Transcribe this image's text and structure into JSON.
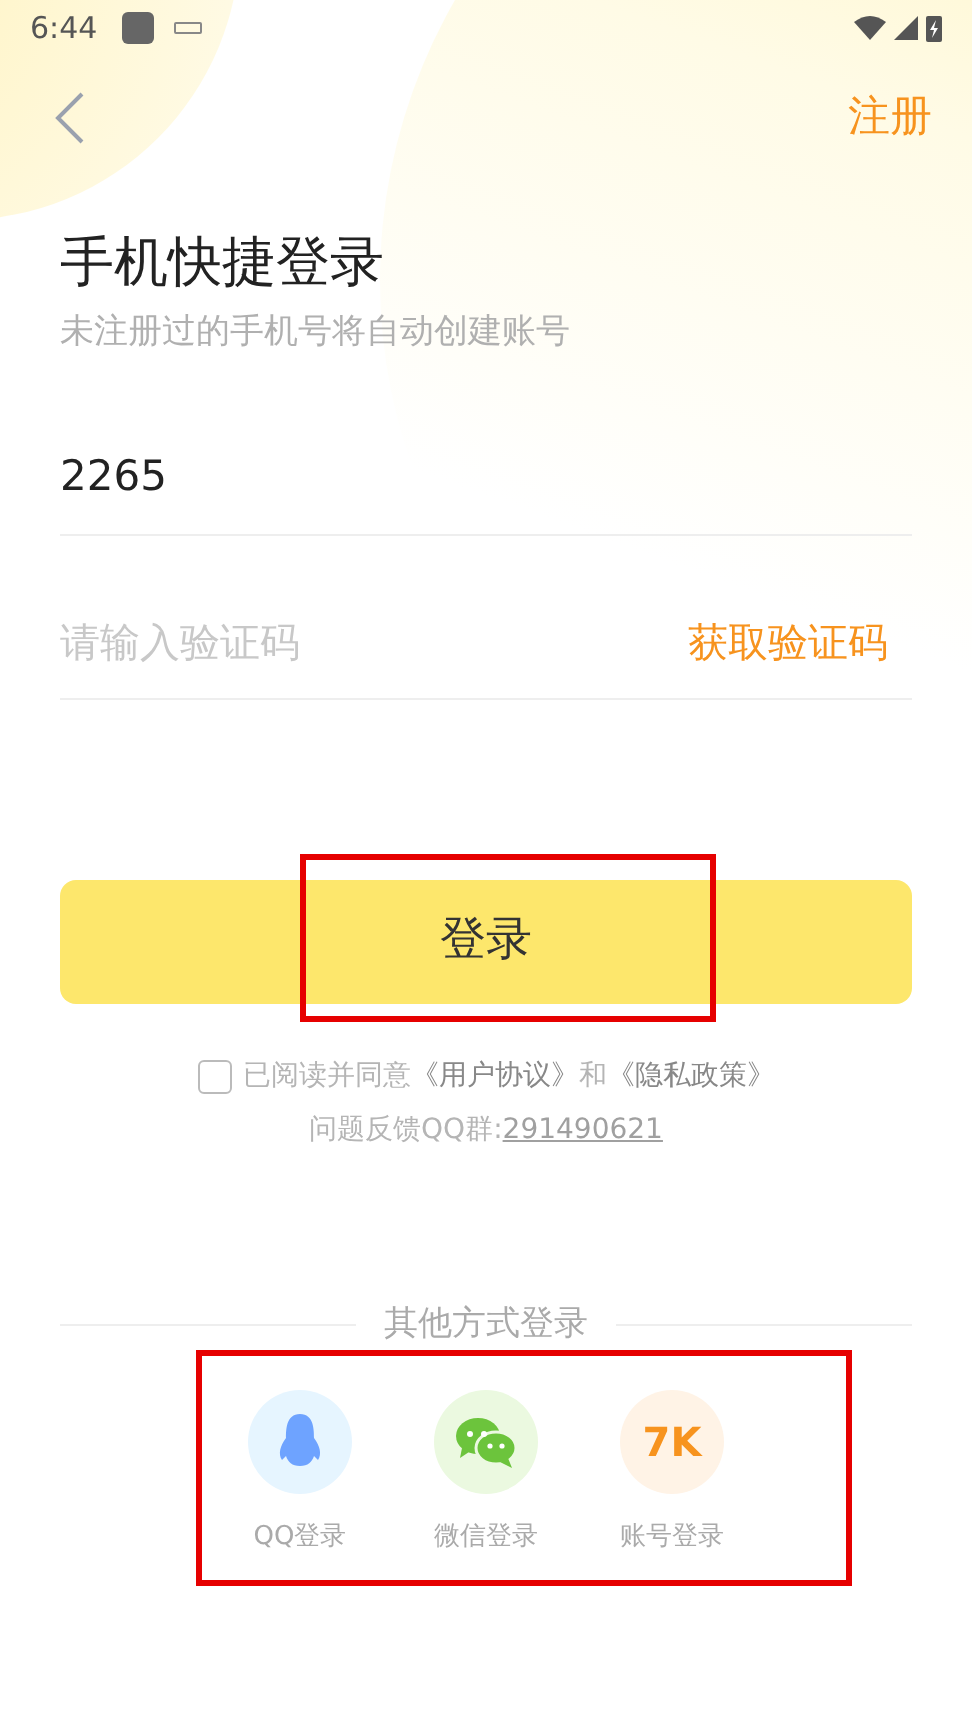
{
  "status_bar": {
    "time": "6:44"
  },
  "header": {
    "register": "注册"
  },
  "title": "手机快捷登录",
  "subtitle": "未注册过的手机号将自动创建账号",
  "phone_field": {
    "value": "2265"
  },
  "code_field": {
    "placeholder": "请输入验证码",
    "action": "获取验证码"
  },
  "login_button": "登录",
  "agreement": {
    "checked": false,
    "prefix": "已阅读并同意",
    "link_1": "《用户协议》",
    "joiner": "和",
    "link_2": "《隐私政策》"
  },
  "feedback": {
    "label": "问题反馈QQ群:",
    "link": "291490621"
  },
  "other_login": {
    "title": "其他方式登录",
    "methods": [
      {
        "kind": "qq",
        "label": "QQ登录"
      },
      {
        "kind": "wechat",
        "label": "微信登录"
      },
      {
        "kind": "account",
        "logo": "7K",
        "label": "账号登录"
      }
    ]
  },
  "annotations": {
    "login_highlighted": true,
    "methods_highlighted": true
  }
}
